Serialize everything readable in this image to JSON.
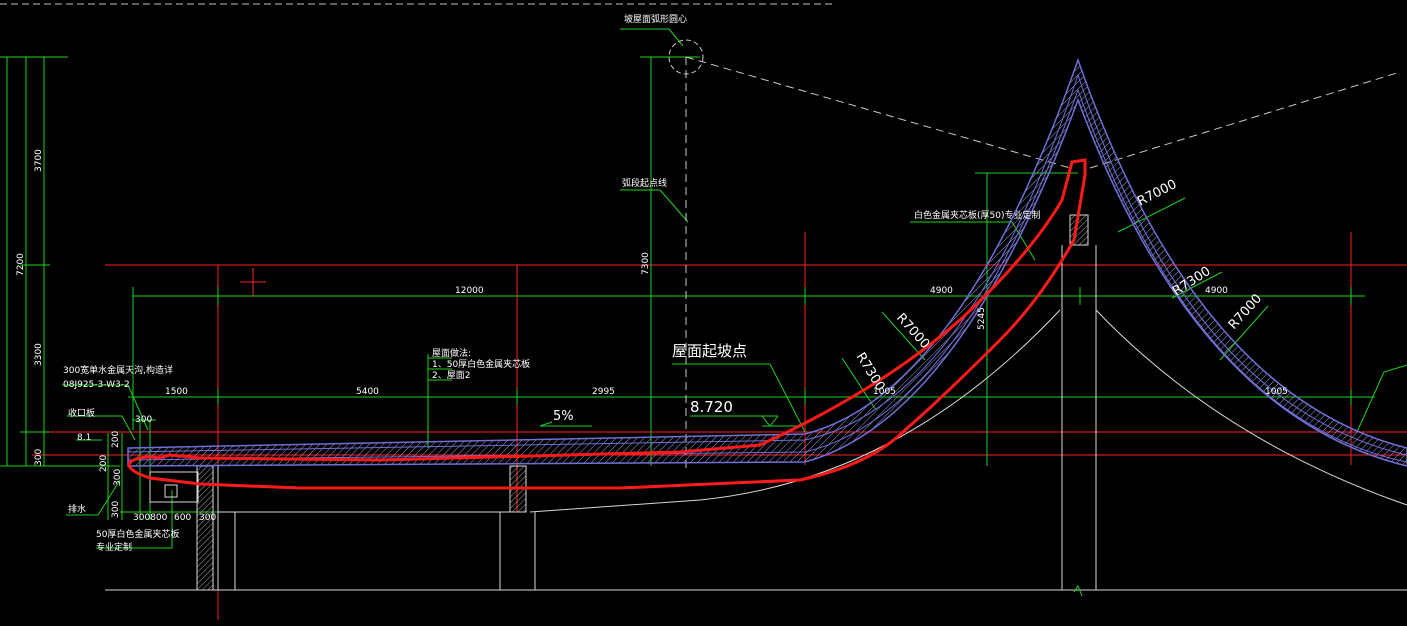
{
  "colors": {
    "background": "#000000",
    "guide_red": "#ff2020",
    "dimension_green": "#19d219",
    "roof_blue": "#6f6fd8",
    "hatch": "#9b9bd8",
    "text": "#ffffff",
    "markup_red": "#ff1a1a",
    "outline_white": "#d8d8d8",
    "dash_white": "#c8c8c8"
  },
  "annotations": {
    "roof_slope_center": "坡屋面弧形圆心",
    "arc_start_line": "弧段起点线",
    "metal_panel": "白色金属夹芯板(厚50)专业定制",
    "roof_start_point": "屋面起坡点",
    "elevation": "8.720",
    "slope": "5%",
    "roof_method_title": "屋面做法:",
    "roof_method_1": "1、50厚白色金属夹芯板",
    "roof_method_2": "2、屋面2",
    "gutter_note_1": "300宽单水金属天沟,构造详",
    "gutter_note_2": "08J925-3-W3-2",
    "eave_board": "收口板",
    "drain": "排水",
    "panel_note_1": "50厚白色金属夹芯板",
    "panel_note_2": "专业定制",
    "level_81": "8.1"
  },
  "dimensions": {
    "d12000": "12000",
    "d4900_left": "4900",
    "d4900_right": "4900",
    "d1500": "1500",
    "d5400": "5400",
    "d2995": "2995",
    "d1005_left": "1005",
    "d1005_right": "1005",
    "d7300_vertical": "7300",
    "d5245": "5245",
    "d3700": "3700",
    "d7200": "7200",
    "d3300": "3300",
    "d300_bottom": "300",
    "d300_a": "300",
    "d200_a": "200",
    "d200_b": "200",
    "d300_b": "300",
    "d300_c": "300",
    "d300800": "300800",
    "d600": "600",
    "d300_d": "300"
  },
  "radii": {
    "r7000_top": "R7000",
    "r7300_right": "R7300",
    "r7000_right": "R7000",
    "r7000_left": "R7000",
    "r7300_left": "R7300"
  }
}
